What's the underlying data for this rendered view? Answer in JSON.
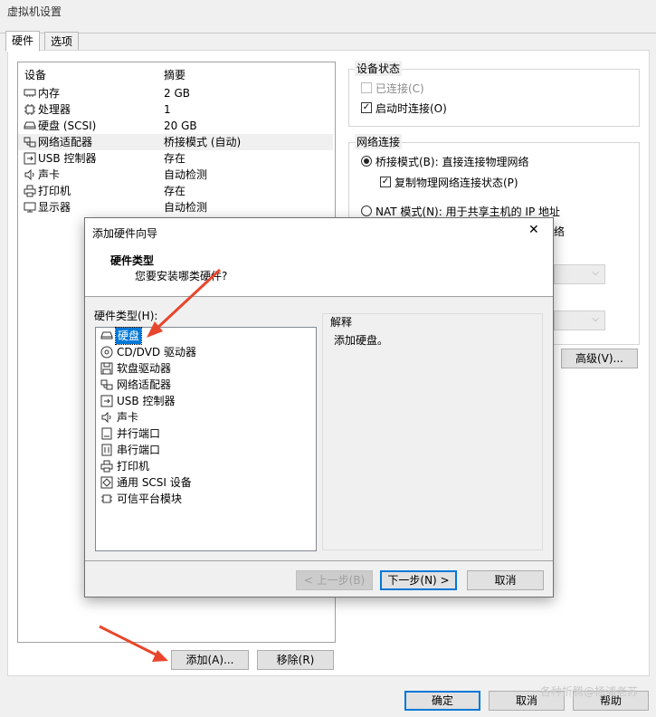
{
  "window": {
    "title": "虚拟机设置"
  },
  "tabs": [
    {
      "label": "硬件"
    },
    {
      "label": "选项"
    }
  ],
  "device_list": {
    "headers": {
      "device": "设备",
      "summary": "摘要"
    },
    "rows": [
      {
        "icon": "memory-icon",
        "name": "内存",
        "summary": "2 GB"
      },
      {
        "icon": "cpu-icon",
        "name": "处理器",
        "summary": "1"
      },
      {
        "icon": "disk-icon",
        "name": "硬盘 (SCSI)",
        "summary": "20 GB"
      },
      {
        "icon": "network-icon",
        "name": "网络适配器",
        "summary": "桥接模式 (自动)"
      },
      {
        "icon": "usb-icon",
        "name": "USB 控制器",
        "summary": "存在"
      },
      {
        "icon": "speaker-icon",
        "name": "声卡",
        "summary": "自动检测"
      },
      {
        "icon": "printer-icon",
        "name": "打印机",
        "summary": "存在"
      },
      {
        "icon": "monitor-icon",
        "name": "显示器",
        "summary": "自动检测"
      }
    ]
  },
  "device_buttons": {
    "add": "添加(A)...",
    "remove": "移除(R)"
  },
  "device_status": {
    "title": "设备状态",
    "connected": "已连接(C)",
    "connect_on_start": "启动时连接(O)"
  },
  "network": {
    "title": "网络连接",
    "bridged": "桥接模式(B): 直接连接物理网络",
    "replicate": "复制物理网络连接状态(P)",
    "nat": "NAT 模式(N): 用于共享主机的 IP 地址",
    "partial_right": "络",
    "advanced": "高级(V)..."
  },
  "main_buttons": {
    "ok": "确定",
    "cancel": "取消",
    "help": "帮助"
  },
  "dialog": {
    "title": "添加硬件向导",
    "close": "✕",
    "header_title": "硬件类型",
    "header_subtitle": "您要安装哪类硬件?",
    "list_label": "硬件类型(H):",
    "items": [
      {
        "icon": "disk-icon",
        "label": "硬盘"
      },
      {
        "icon": "cd-dvd-icon",
        "label": "CD/DVD 驱动器"
      },
      {
        "icon": "floppy-icon",
        "label": "软盘驱动器"
      },
      {
        "icon": "network-icon",
        "label": "网络适配器"
      },
      {
        "icon": "usb-icon",
        "label": "USB 控制器"
      },
      {
        "icon": "speaker-icon",
        "label": "声卡"
      },
      {
        "icon": "parallel-port-icon",
        "label": "并行端口"
      },
      {
        "icon": "serial-port-icon",
        "label": "串行端口"
      },
      {
        "icon": "printer-icon",
        "label": "打印机"
      },
      {
        "icon": "scsi-icon",
        "label": "通用 SCSI 设备"
      },
      {
        "icon": "tpm-icon",
        "label": "可信平台模块"
      }
    ],
    "explain_title": "解释",
    "explain_text": "添加硬盘。",
    "back": "< 上一步(B)",
    "next": "下一步(N) >",
    "cancel": "取消"
  },
  "watermark": "各种折腾@杨浦老苏",
  "colors": {
    "accent": "#0078d7",
    "arrow": "#e8452c"
  }
}
